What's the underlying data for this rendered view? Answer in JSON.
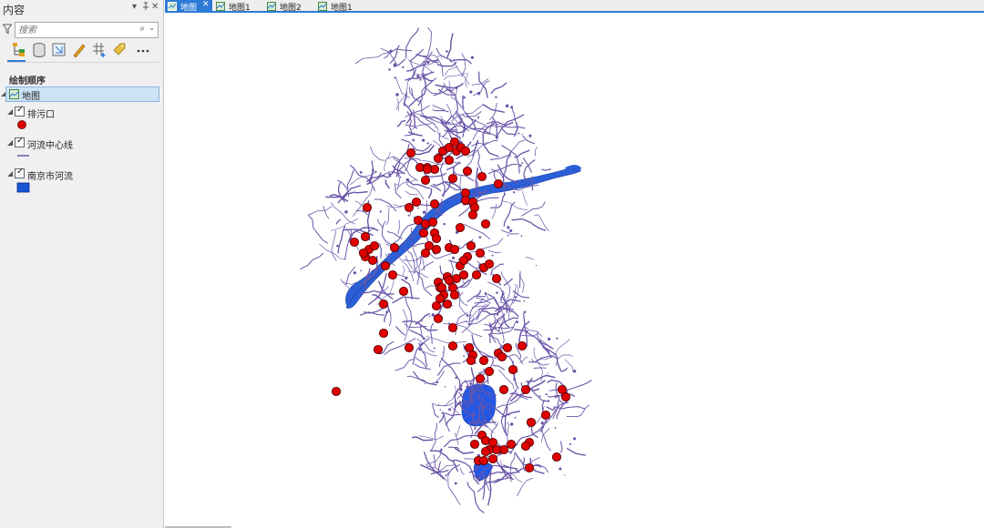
{
  "pane": {
    "title": "内容",
    "search_placeholder": "搜索",
    "section_title": "绘制顺序"
  },
  "tree": {
    "map": {
      "label": "地图",
      "checked": false
    },
    "layers": [
      {
        "label": "排污口",
        "checked": true,
        "symbol": "red-circle"
      },
      {
        "label": "河流中心线",
        "checked": true,
        "symbol": "purple-line"
      },
      {
        "label": "南京市河流",
        "checked": true,
        "symbol": "blue-fill"
      }
    ]
  },
  "tabs": [
    {
      "label": "地图",
      "active": true
    },
    {
      "label": "地图1",
      "active": false
    },
    {
      "label": "地图2",
      "active": false
    },
    {
      "label": "地图1",
      "active": false
    }
  ],
  "colors": {
    "accent": "#2d7bd6",
    "outlet_fill": "#e00000",
    "river_line": "#6a56a8",
    "river_fill": "#2b5fd8"
  },
  "icons": {
    "filter": "filter-icon",
    "search": "search-icon",
    "toolbar": [
      "list-by-drawing-order-icon",
      "list-by-source-icon",
      "list-by-selection-icon",
      "list-by-editing-icon",
      "list-by-snapping-icon",
      "list-by-labeling-icon",
      "more-icon"
    ]
  }
}
